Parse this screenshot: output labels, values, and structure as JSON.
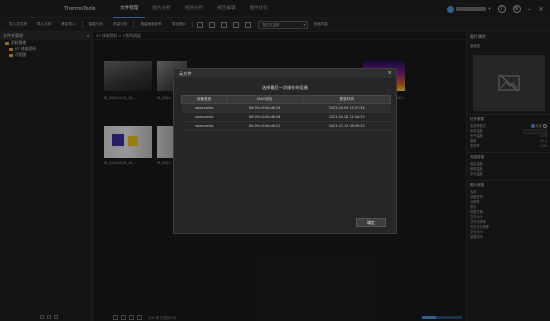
{
  "app": {
    "name": "ThermoTools"
  },
  "menu": [
    "文件管理",
    "图片分析",
    "视频分析",
    "报告编辑",
    "图件优化"
  ],
  "toolbar": {
    "items": [
      "导入文件夹",
      "导入文件",
      "移至导入",
      "智能分析",
      "批量分析",
      "批量面板制作",
      "导出图片"
    ],
    "select_value": "按文件名称",
    "last_item": "全部内容"
  },
  "left_panel": {
    "header": "文件夹管理",
    "tree": [
      {
        "label": "资料整理",
        "level": 0
      },
      {
        "label": "07 体能资料",
        "level": 1
      },
      {
        "label": "可视图",
        "level": 1
      }
    ]
  },
  "main": {
    "breadcrumb": "07 体能资料 > C系列测温",
    "thumbnails": [
      {
        "caption": "IR_20201212_10…"
      },
      {
        "caption": "IR_2020"
      },
      {
        "caption": "IR_2021…"
      },
      {
        "caption": "IR_20210226_10…"
      },
      {
        "caption": "IR_2020"
      }
    ],
    "status_text": "共12项 已选择1项"
  },
  "right_panel": {
    "title": "图片属性",
    "sub": "缩略图",
    "sections": [
      {
        "title": "红外参数",
        "rows": [
          {
            "label": "发射率模式",
            "value": "标准"
          },
          {
            "label": "反射温度",
            "value": "20"
          },
          {
            "label": "大气温度",
            "value": "0.00"
          },
          {
            "label": "距离",
            "value": "-40.0"
          },
          {
            "label": "发射率",
            "value": "0.95"
          }
        ]
      },
      {
        "title": "测温参数",
        "rows": [
          {
            "label": "最高温度",
            "value": ""
          },
          {
            "label": "最低温度",
            "value": ""
          },
          {
            "label": "平均温度",
            "value": ""
          }
        ]
      },
      {
        "title": "图片参数",
        "rows": [
          {
            "label": "名称",
            "value": ""
          },
          {
            "label": "设备型号",
            "value": ""
          },
          {
            "label": "分辨率",
            "value": ""
          },
          {
            "label": "镜头",
            "value": ""
          },
          {
            "label": "拍摄日期",
            "value": ""
          },
          {
            "label": "文件大小",
            "value": ""
          },
          {
            "label": "红外分辨率",
            "value": ""
          },
          {
            "label": "可见光分辨率",
            "value": ""
          },
          {
            "label": "文件大小",
            "value": ""
          },
          {
            "label": "拍摄时间",
            "value": ""
          }
        ]
      }
    ]
  },
  "dialog": {
    "title": "云文件",
    "heading": "选择最后一次操作的设备",
    "columns": [
      "设备类型",
      "MAC地址",
      "登录时间"
    ],
    "rows": [
      {
        "type": "newcarries",
        "mac": "80:09:c3:0b:d6:24",
        "time": "2023-04-09 15:37:34"
      },
      {
        "type": "newcarries",
        "mac": "80:09:c3:0b:d6:56",
        "time": "2023-04-28 12:44:29"
      },
      {
        "type": "newcarries",
        "mac": "80:09:c3:0b:d6:21",
        "time": "2023-07-12 08:09:55"
      }
    ],
    "confirm": "确定"
  }
}
